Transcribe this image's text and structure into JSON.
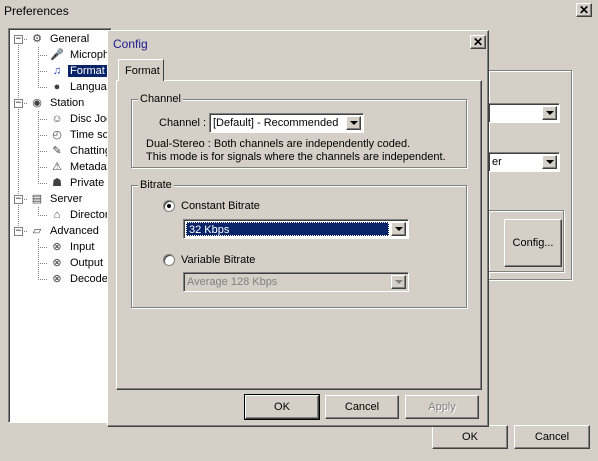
{
  "main_window": {
    "title": "Preferences",
    "close_symbol": "✕",
    "ok_label": "OK",
    "cancel_label": "Cancel",
    "bg_config_label": "Config...",
    "bg_combo2_partial": "er"
  },
  "tree": {
    "items": [
      {
        "label": "General",
        "icon": "general-icon",
        "expander": "−"
      },
      {
        "label": "Microphe",
        "icon": "microphone-icon"
      },
      {
        "label": "Format",
        "icon": "music-note-icon"
      },
      {
        "label": "Languag",
        "icon": "language-icon"
      },
      {
        "label": "Station",
        "icon": "station-icon",
        "expander": "−"
      },
      {
        "label": "Disc Joc",
        "icon": "disc-jockey-icon"
      },
      {
        "label": "Time sch",
        "icon": "clock-icon"
      },
      {
        "label": "Chatting",
        "icon": "chat-icon"
      },
      {
        "label": "Metadat",
        "icon": "warning-icon"
      },
      {
        "label": "Private",
        "icon": "private-icon"
      },
      {
        "label": "Server",
        "icon": "server-icon",
        "expander": "−"
      },
      {
        "label": "Director",
        "icon": "directory-icon"
      },
      {
        "label": "Advanced",
        "icon": "advanced-icon",
        "expander": "−"
      },
      {
        "label": "Input",
        "icon": "input-icon"
      },
      {
        "label": "Output",
        "icon": "output-icon"
      },
      {
        "label": "Decoder",
        "icon": "decoder-icon"
      }
    ]
  },
  "config_dialog": {
    "title": "Config",
    "close_symbol": "✕",
    "tab_label": "Format",
    "channel": {
      "group_label": "Channel",
      "field_label": "Channel :",
      "value": "[Default] - Recommended",
      "desc_line1": "Dual-Stereo : Both channels are independently coded.",
      "desc_line2": "This mode is for signals where the channels are independent."
    },
    "bitrate": {
      "group_label": "Bitrate",
      "constant_label": "Constant Bitrate",
      "constant_checked": true,
      "constant_value": "32 Kbps",
      "variable_label": "Variable Bitrate",
      "variable_checked": false,
      "variable_value": "Average 128 Kbps"
    },
    "ok_label": "OK",
    "cancel_label": "Cancel",
    "apply_label": "Apply"
  },
  "colors": {
    "titlebar_active": "#0a246a",
    "selection": "#0a246a",
    "face": "#d4d0c8"
  }
}
